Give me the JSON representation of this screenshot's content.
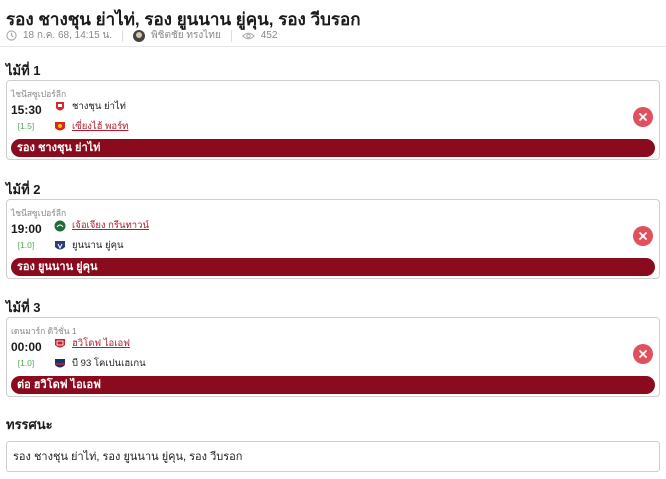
{
  "article": {
    "title": "รอง ชางชุน ย่าไท่, รอง ยูนนาน ยู่คุน, รอง วีบรอก",
    "date": "18 ก.ค. 68, 14:15 น.",
    "author": "พิชิตชัย ทรงไทย",
    "views": "452"
  },
  "picks": [
    {
      "heading": "ไม้ที่ 1",
      "league": "ไชนีสซูเปอร์ลีก",
      "time": "15:30",
      "odds": "[1.5]",
      "home": {
        "name": "ชางชุน ย่าไท่",
        "logo": "changchun-yatai-logo",
        "color": "#d22b2b",
        "favorite": false
      },
      "away": {
        "name": "เซี่ยงไฮ้ พอร์ท",
        "logo": "shanghai-port-logo",
        "color": "#d6281f",
        "favorite": true
      },
      "tip": "รอง ชางชุน ย่าไท่"
    },
    {
      "heading": "ไม้ที่ 2",
      "league": "ไชนีสซูเปอร์ลีก",
      "time": "19:00",
      "odds": "[1.0]",
      "home": {
        "name": "เจ้อเจียง กรีนทาวน์",
        "logo": "zhejiang-greentown-logo",
        "color": "#1f6b3a",
        "favorite": true
      },
      "away": {
        "name": "ยูนนาน ยู่คุน",
        "logo": "yunnan-yukun-logo",
        "color": "#2a3f7a",
        "favorite": false
      },
      "tip": "รอง ยูนนาน ยู่คุน"
    },
    {
      "heading": "ไม้ที่ 3",
      "league": "เดนมาร์ก ดิวิชั่น 1",
      "time": "00:00",
      "odds": "[1.0]",
      "home": {
        "name": "ฮวิโดฟ ไอเอฟ",
        "logo": "hvidovre-if-logo",
        "color": "#c81e2d",
        "favorite": true
      },
      "away": {
        "name": "บี 93 โคเปนเฮเกน",
        "logo": "b93-copenhagen-logo",
        "color": "#1d2f6b",
        "favorite": false
      },
      "tip": "ต่อ ฮวิโดฟ ไอเอฟ"
    }
  ],
  "summary": {
    "heading": "ทรรศนะ",
    "text": "รอง ชางชุน ย่าไท่, รอง ยูนนาน ยู่คุน, รอง วีบรอก"
  },
  "colors": {
    "tip_bar": "#8a0a1e",
    "remove_button": "#e0505f",
    "odds": "#4caf50",
    "favorite_team": "#b01e2f"
  },
  "icons": {
    "date": "clock-icon",
    "views": "eye-icon",
    "remove": "close-icon"
  }
}
